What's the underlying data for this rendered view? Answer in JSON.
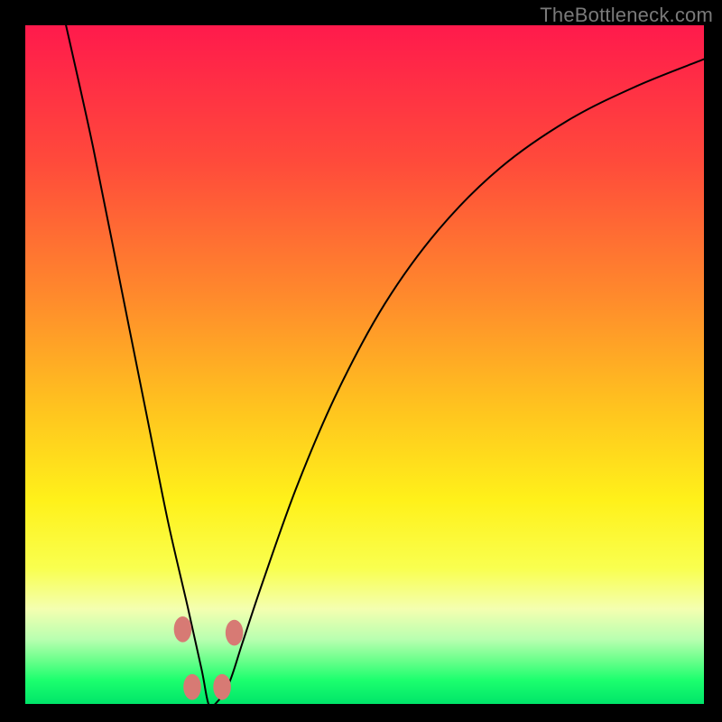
{
  "watermark": "TheBottleneck.com",
  "colors": {
    "background": "#000000",
    "curve_stroke": "#000000",
    "marker_fill": "#d77a74",
    "gradient_stops": [
      {
        "offset": 0.0,
        "hex": "#ff1a4c"
      },
      {
        "offset": 0.2,
        "hex": "#ff4a3b"
      },
      {
        "offset": 0.4,
        "hex": "#ff8a2c"
      },
      {
        "offset": 0.56,
        "hex": "#ffc21f"
      },
      {
        "offset": 0.7,
        "hex": "#fff11a"
      },
      {
        "offset": 0.8,
        "hex": "#f9ff4f"
      },
      {
        "offset": 0.86,
        "hex": "#f4ffb0"
      },
      {
        "offset": 0.905,
        "hex": "#b8ffb0"
      },
      {
        "offset": 0.935,
        "hex": "#6cff8c"
      },
      {
        "offset": 0.965,
        "hex": "#1cff6e"
      },
      {
        "offset": 1.0,
        "hex": "#00e569"
      }
    ]
  },
  "chart_data": {
    "type": "line",
    "title": "",
    "xlabel": "",
    "ylabel": "",
    "xlim": [
      0,
      100
    ],
    "ylim": [
      0,
      100
    ],
    "note": "V-shaped bottleneck curve; minimum (optimal) near x≈27, y≈0. Values estimated from pixels on a 0–100 normalized scale.",
    "series": [
      {
        "name": "bottleneck-curve",
        "x": [
          6,
          10,
          14,
          18,
          21,
          24,
          26,
          27,
          28,
          30,
          32,
          35,
          40,
          46,
          53,
          61,
          70,
          80,
          90,
          100
        ],
        "y": [
          100,
          82,
          62,
          42,
          27,
          14,
          5,
          0,
          0,
          3,
          9,
          18,
          32,
          46,
          59,
          70,
          79,
          86,
          91,
          95
        ]
      }
    ],
    "markers": {
      "name": "highlight-points",
      "x": [
        23.2,
        24.6,
        29.0,
        30.8
      ],
      "y": [
        11.0,
        2.5,
        2.5,
        10.5
      ]
    }
  }
}
